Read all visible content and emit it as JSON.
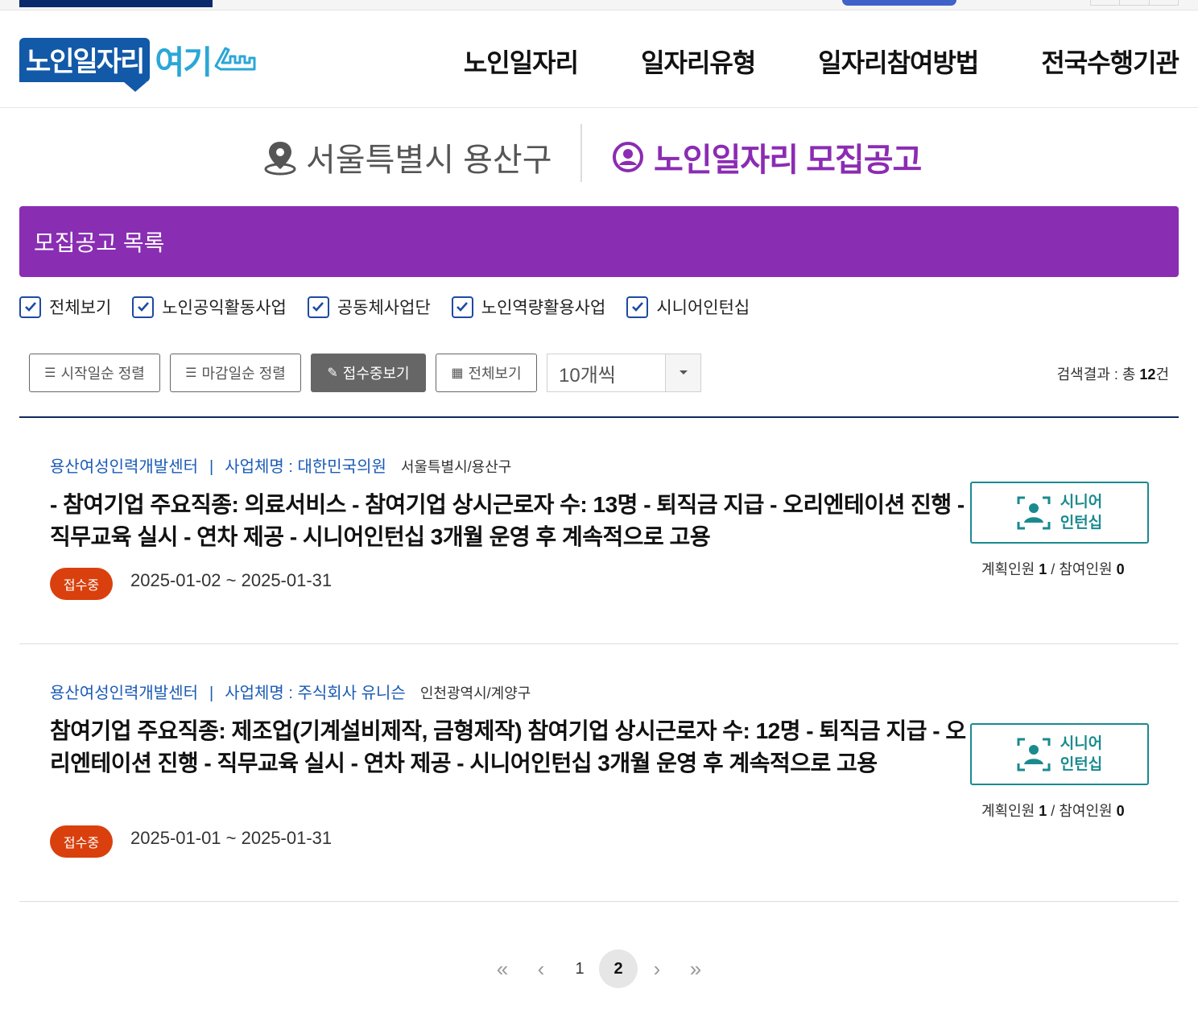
{
  "site": {
    "logo_text": "노인일자리",
    "logo_sub": "여기"
  },
  "nav": [
    {
      "label": "노인일자리"
    },
    {
      "label": "일자리유형"
    },
    {
      "label": "일자리참여방법"
    },
    {
      "label": "전국수행기관"
    }
  ],
  "location": {
    "region": "서울특별시 용산구",
    "board_title": "노인일자리 모집공고"
  },
  "section_title": "모집공고 목록",
  "filters": [
    {
      "label": "전체보기",
      "checked": true
    },
    {
      "label": "노인공익활동사업",
      "checked": true
    },
    {
      "label": "공동체사업단",
      "checked": true
    },
    {
      "label": "노인역량활용사업",
      "checked": true
    },
    {
      "label": "시니어인턴십",
      "checked": true
    }
  ],
  "toolbar": {
    "sort_start": "시작일순 정렬",
    "sort_end": "마감일순 정렬",
    "view_open": "접수중보기",
    "view_all": "전체보기",
    "page_size": "10개씩",
    "result_prefix": "검색결과 : 총 ",
    "result_count": "12",
    "result_suffix": "건"
  },
  "items": [
    {
      "org": "용산여성인력개발센터",
      "separator": "|",
      "company": "사업체명 : 대한민국의원",
      "address": "서울특별시/용산구",
      "title": "- 참여기업 주요직종: 의료서비스 - 참여기업 상시근로자 수: 13명 - 퇴직금 지급 - 오리엔테이션 진행 - 직무교육 실시 - 연차 제공 - 시니어인턴십 3개월 운영 후 계속적으로 고용",
      "status": "접수중",
      "period": "2025-01-02 ~ 2025-01-31",
      "type_line1": "시니어",
      "type_line2": "인턴십",
      "planned_label": "계획인원",
      "planned": "1",
      "slash": "/",
      "joined_label": "참여인원",
      "joined": "0"
    },
    {
      "org": "용산여성인력개발센터",
      "separator": "|",
      "company": "사업체명 : 주식회사 유니슨",
      "address": "인천광역시/계양구",
      "title": "참여기업 주요직종: 제조업(기계설비제작, 금형제작) 참여기업 상시근로자 수: 12명 - 퇴직금 지급 - 오리엔테이션 진행 - 직무교육 실시 - 연차 제공 - 시니어인턴십 3개월 운영 후 계속적으로 고용",
      "status": "접수중",
      "period": "2025-01-01 ~ 2025-01-31",
      "type_line1": "시니어",
      "type_line2": "인턴십",
      "planned_label": "계획인원",
      "planned": "1",
      "slash": "/",
      "joined_label": "참여인원",
      "joined": "0"
    }
  ],
  "pagination": {
    "first": "«",
    "prev": "‹",
    "pages": [
      "1",
      "2"
    ],
    "current": "2",
    "next": "›",
    "last": "»"
  },
  "colors": {
    "purple": "#892db3",
    "navy": "#0f2a5c",
    "badge": "#d9400d",
    "teal": "#1a8a8f",
    "link": "#1a5bb5"
  }
}
